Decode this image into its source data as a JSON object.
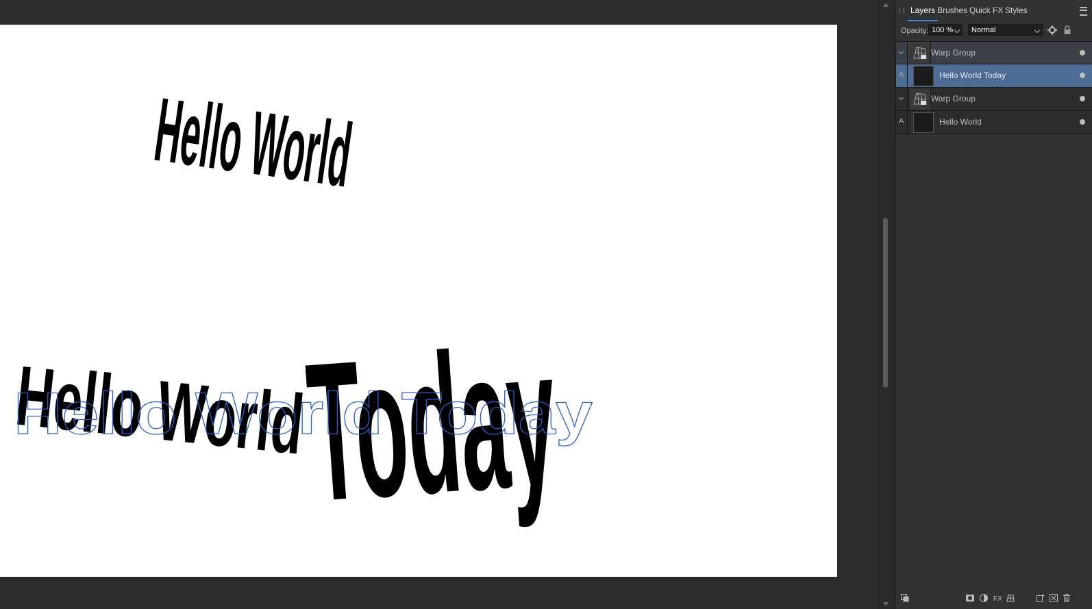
{
  "panel": {
    "tabs": [
      {
        "label": "Layers",
        "active": true
      },
      {
        "label": "Brushes",
        "active": false
      },
      {
        "label": "Quick FX",
        "active": false
      },
      {
        "label": "Styles",
        "active": false
      }
    ],
    "opacity_label": "Opacity:",
    "opacity_value": "100 %",
    "blend_mode": "Normal",
    "layers": [
      {
        "name": "Warp Group",
        "kind": "group",
        "state": "group-selected"
      },
      {
        "name": "Hello World Today",
        "kind": "text",
        "state": "selected"
      },
      {
        "name": "Warp Group",
        "kind": "group",
        "state": "normal"
      },
      {
        "name": "Hello World",
        "kind": "text",
        "state": "normal"
      }
    ]
  },
  "canvas": {
    "warped_text_top": "Hello World",
    "warped_text_bottom": "Hello World Today",
    "outline_text": "Hello World Today",
    "background": "#ffffff",
    "outline_color": "#2a5fd0"
  },
  "colors": {
    "accent": "#4a8ad8",
    "selected_row": "#4c6c95"
  }
}
